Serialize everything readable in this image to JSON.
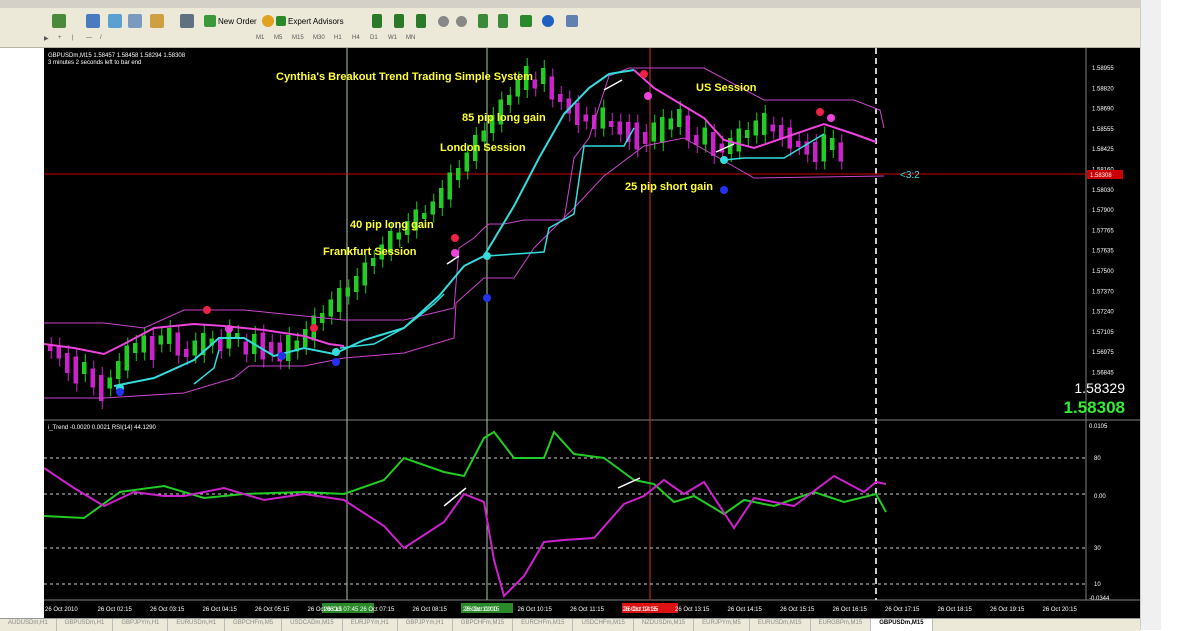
{
  "toolbar": {
    "new_order": "New Order",
    "expert_advisors": "Expert Advisors",
    "timeframes": [
      "M1",
      "M5",
      "M15",
      "M30",
      "H1",
      "H4",
      "D1",
      "W1",
      "MN"
    ]
  },
  "chart": {
    "header_line1": "GBPUSDm,M15  1.58457 1.58458 1.58294 1.58308",
    "header_line2": "3 minutes 2 seconds left to bar end",
    "title": "Cynthia's Breakout Trend Trading Simple System",
    "annotations": {
      "us": "US Session",
      "pip85": "85 pip long gain",
      "london": "London Session",
      "pip25": "25 pip short gain",
      "pip40": "40 pip long gain",
      "frankfurt": "Frankfurt Session",
      "ratio": "<3:2"
    },
    "price_bid": "1.58329",
    "price_ask": "1.58308",
    "price_current_box": "1.58308",
    "price_axis": [
      "1.58955",
      "1.58820",
      "1.58690",
      "1.58555",
      "1.58425",
      "1.58160",
      "1.58030",
      "1.57900",
      "1.57765",
      "1.57635",
      "1.57500",
      "1.57370",
      "1.57240",
      "1.57105",
      "1.56975",
      "1.56845"
    ],
    "colors": {
      "bull": "#22cc22",
      "bear": "#cc22cc",
      "cyan": "#33dddd",
      "magenta": "#ee44dd",
      "session": "#ffff33",
      "hline": "#cc0000"
    }
  },
  "indicator": {
    "header": "i_Trend -0.0020 0.0021  RSI(14) 44.1290",
    "axis": [
      "0.0105",
      "80",
      "0.00",
      "30",
      "10",
      "-0.0344"
    ]
  },
  "time_axis": {
    "labels": [
      "26 Oct 2010",
      "26 Oct 02:15",
      "26 Oct 03:15",
      "26 Oct 04:15",
      "26 Oct 05:15",
      "26 Oct 06:15",
      "26 Oct 07:15",
      "26 Oct 08:15",
      "26 Oct 09:15",
      "26 Oct 10:15",
      "26 Oct 11:15",
      "26 Oct 12:15",
      "26 Oct 13:15",
      "26 Oct 14:15",
      "26 Oct 15:15",
      "26 Oct 16:15",
      "26 Oct 17:15",
      "26 Oct 18:15",
      "26 Oct 19:15",
      "26 Oct 20:15"
    ],
    "highlight_green": "26 Oct 07:45",
    "highlight_green2": "26 Oct 11:00",
    "highlight_red": "26 Oct 14:35"
  },
  "tabs": [
    "AUDUSDm,H1",
    "GBPUSDm,H1",
    "GBPJPYm,H1",
    "EURUSDm,H1",
    "GBPCHFm,M5",
    "USDCADm,M15",
    "EURJPYm,H1",
    "GBPJPYm,H1",
    "GBPCHFm,M15",
    "EURCHFm,M15",
    "USDCHFm,M15",
    "NZDUSDm,M15",
    "EURJPYm,M5",
    "EURUSDm,M15",
    "EURGBPm,M15",
    "GBPUSDm,M15"
  ],
  "active_tab": "GBPUSDm,M15"
}
